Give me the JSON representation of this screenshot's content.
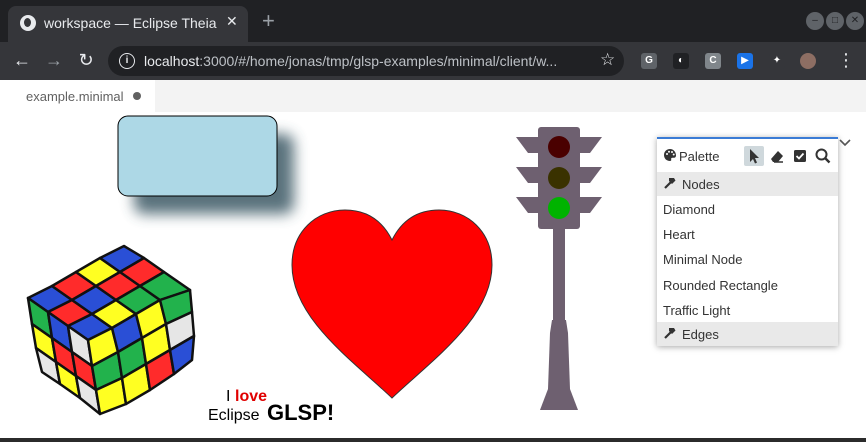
{
  "browser": {
    "tab_title": "workspace — Eclipse Theia",
    "tab_close": "✕",
    "new_tab": "+",
    "window_controls": [
      "–",
      "□",
      "✕"
    ],
    "nav": {
      "back": "←",
      "forward": "→",
      "reload": "↻"
    },
    "url_host": "localhost",
    "url_rest": ":3000/#/home/jonas/tmp/glsp-examples/minimal/client/w...",
    "bookmark_star": "☆",
    "extensions": [
      {
        "name": "g-extension-icon",
        "letter": "G",
        "color": "#5f6368"
      },
      {
        "name": "circle-extension-icon",
        "letter": "◐",
        "color": "#202124"
      },
      {
        "name": "c-extension-icon",
        "letter": "C",
        "color": "#80868b"
      },
      {
        "name": "camera-extension-icon",
        "letter": "▶",
        "color": "#1a73e8"
      },
      {
        "name": "puzzle-extension-icon",
        "letter": "✦",
        "color": "#35363a"
      }
    ],
    "menu": "⋮"
  },
  "editor": {
    "tab_label": "example.minimal"
  },
  "diagram": {
    "text_i": "I",
    "text_love": "love",
    "text_eclipse": "Eclipse",
    "text_glsp": "GLSP!",
    "colors": {
      "rect_fill": "#add8e6",
      "heart_fill": "#ff0000",
      "light_red": "#4a0000",
      "light_yellow": "#3a3200",
      "light_green": "#00b300",
      "pole": "#6e6070"
    }
  },
  "palette": {
    "title": "Palette",
    "groups": [
      {
        "label": "Nodes",
        "items": [
          "Diamond",
          "Heart",
          "Minimal Node",
          "Rounded Rectangle",
          "Traffic Light"
        ]
      },
      {
        "label": "Edges",
        "items": []
      }
    ]
  }
}
